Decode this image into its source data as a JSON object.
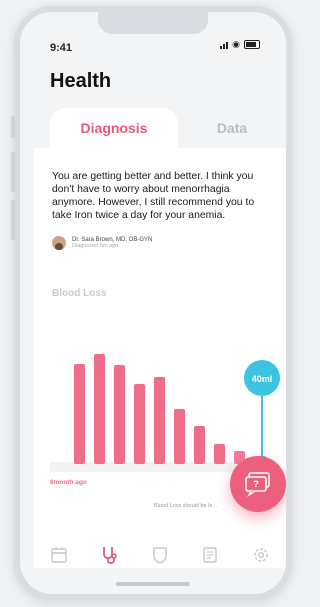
{
  "status": {
    "time": "9:41"
  },
  "header": {
    "title": "Health"
  },
  "tabs": [
    {
      "label": "Diagnosis",
      "active": true
    },
    {
      "label": "Data",
      "active": false
    }
  ],
  "diagnosis": {
    "message": "You are getting better and better. I think you don't have to worry about menorrhagia anymore. However, I still recommend you to take Iron twice a day for your anemia.",
    "doctor_name": "Dr. Sara Brown, MD, OB-GYN",
    "doctor_sub": "Diagnosed 5m ago"
  },
  "chart_data": {
    "type": "bar",
    "title": "Blood Loss",
    "values": [
      100,
      110,
      99,
      80,
      87,
      55,
      38,
      20,
      13
    ],
    "start_label": "8month ago",
    "callout": "40ml",
    "footnote": "Blood Loss should be le..."
  },
  "nav": [
    {
      "name": "calendar-icon"
    },
    {
      "name": "stethoscope-icon",
      "active": true
    },
    {
      "name": "shield-icon"
    },
    {
      "name": "document-icon"
    },
    {
      "name": "settings-icon"
    }
  ],
  "colors": {
    "accent": "#e8587a",
    "bar": "#f06d8a",
    "callout": "#3bc3e0"
  }
}
